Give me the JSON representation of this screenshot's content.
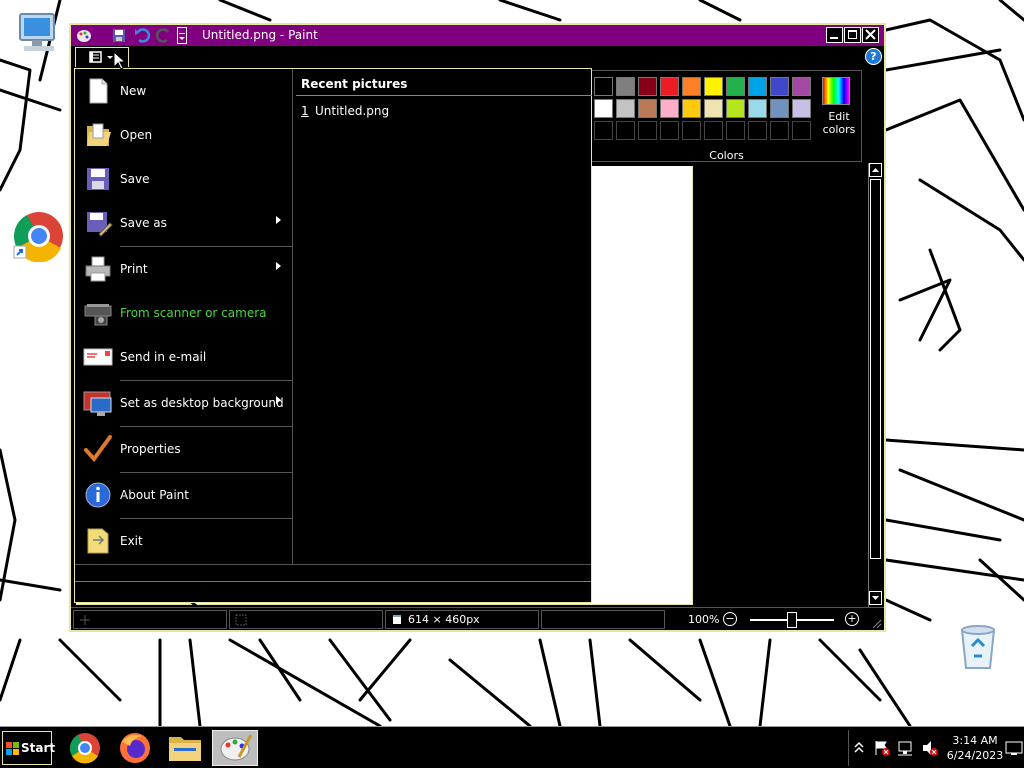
{
  "window": {
    "title": "Untitled.png - Paint"
  },
  "file_menu": {
    "items": [
      {
        "label": "New",
        "icon": "new-document-icon",
        "submenu": false
      },
      {
        "label": "Open",
        "icon": "open-folder-icon",
        "submenu": false
      },
      {
        "label": "Save",
        "icon": "floppy-disk-icon",
        "submenu": false
      },
      {
        "label": "Save as",
        "icon": "save-as-icon",
        "submenu": true
      },
      {
        "label": "Print",
        "icon": "printer-icon",
        "submenu": true
      },
      {
        "label": "From scanner or camera",
        "icon": "scanner-icon",
        "submenu": false
      },
      {
        "label": "Send in e-mail",
        "icon": "email-icon",
        "submenu": false
      },
      {
        "label": "Set as desktop background",
        "icon": "desktop-background-icon",
        "submenu": true
      },
      {
        "label": "Properties",
        "icon": "checkmark-icon",
        "submenu": false
      },
      {
        "label": "About Paint",
        "icon": "info-icon",
        "submenu": false
      },
      {
        "label": "Exit",
        "icon": "exit-icon",
        "submenu": false
      }
    ],
    "recent_header": "Recent pictures",
    "recent_items": [
      {
        "number": "1",
        "name": "Untitled.png"
      }
    ]
  },
  "colors": {
    "group_label": "Colors",
    "edit_colors_label": "Edit colors",
    "row1": [
      "#000000",
      "#7f7f7f",
      "#880015",
      "#ed1c24",
      "#ff7f27",
      "#fff200",
      "#22b14c",
      "#00a2e8",
      "#3f48cc",
      "#a349a4"
    ],
    "row2": [
      "#ffffff",
      "#c3c3c3",
      "#b97a57",
      "#ffaec9",
      "#ffc90e",
      "#efe4b0",
      "#b5e61d",
      "#99d9ea",
      "#7092be",
      "#c8bfe7"
    ]
  },
  "statusbar": {
    "canvas_size": "614 × 460px",
    "zoom": "100%",
    "zoom_level": 100
  },
  "taskbar": {
    "start_label": "Start",
    "time": "3:14 AM",
    "date": "6/24/2023"
  }
}
